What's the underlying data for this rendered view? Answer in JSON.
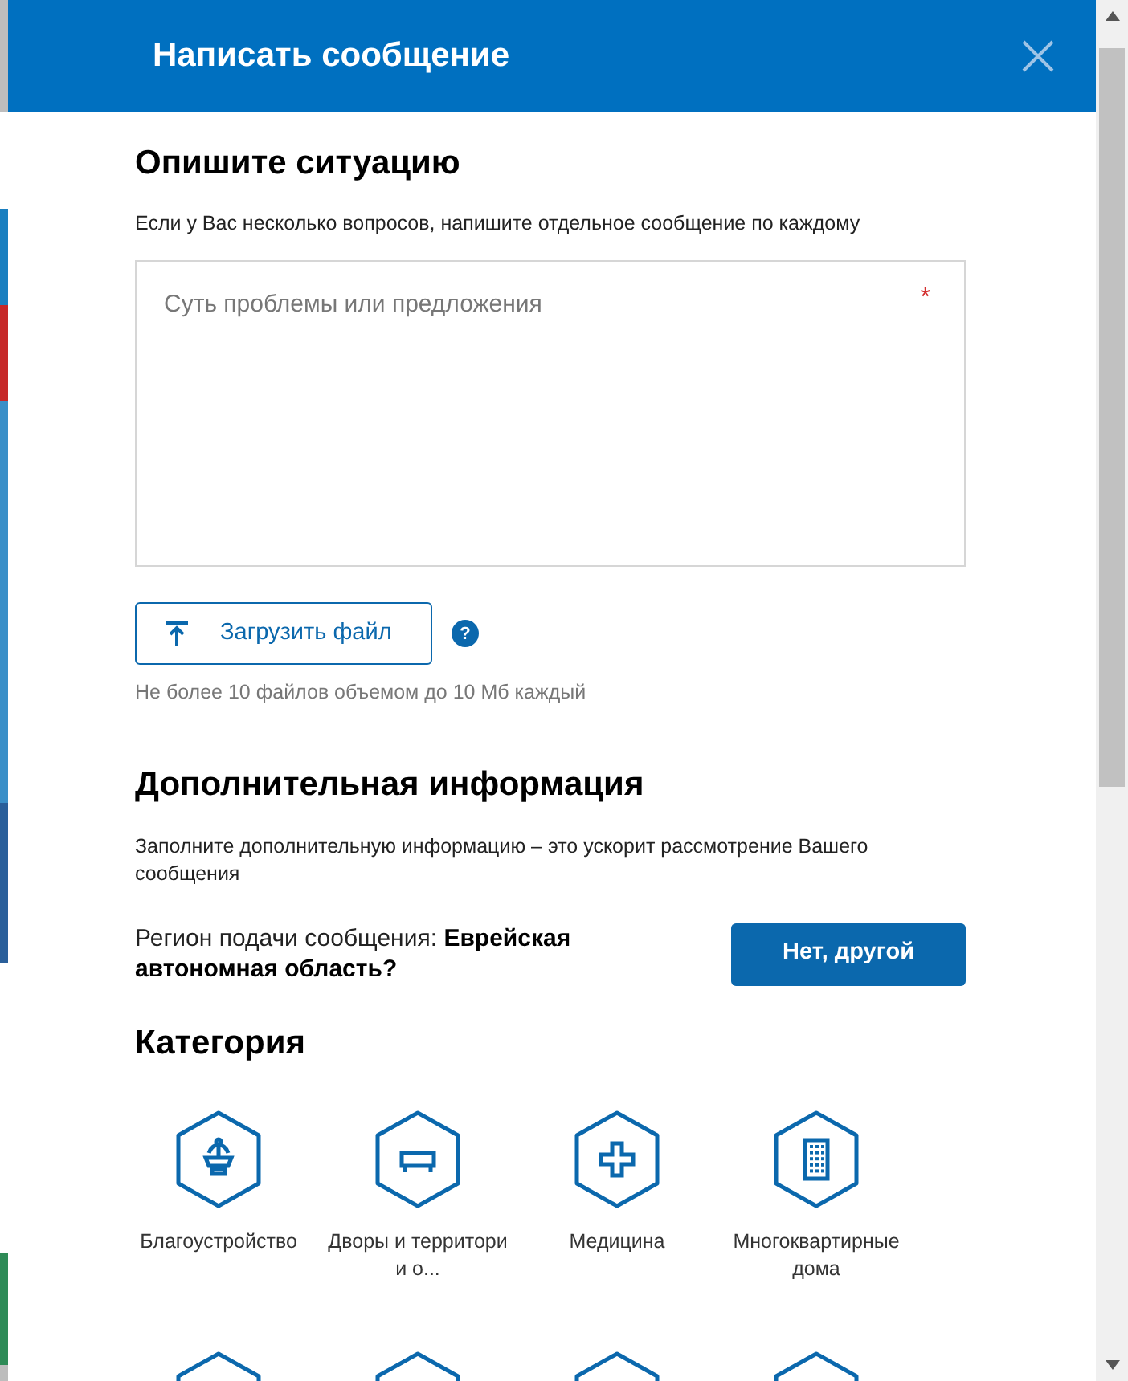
{
  "dialog": {
    "title": "Написать сообщение"
  },
  "describe": {
    "heading": "Опишите ситуацию",
    "hint": "Если у Вас несколько вопросов, напишите отдельное сообщение по каждому",
    "message": {
      "placeholder": "Суть проблемы или предложения",
      "required_mark": "*"
    },
    "upload_button": "Загрузить файл",
    "help": "?",
    "upload_note": "Не более 10 файлов объемом до 10 Мб каждый"
  },
  "additional": {
    "heading": "Дополнительная информация",
    "hint": "Заполните дополнительную информацию – это ускорит рассмотрение Вашего сообщения",
    "region_label": "Регион подачи сообщения:",
    "region_value": "Еврейская автономная область?",
    "other_button": "Нет, другой"
  },
  "category": {
    "heading": "Категория",
    "items": [
      {
        "kind": "labeled",
        "label": "Благоустройство"
      },
      {
        "kind": "labeled",
        "label": "Дворы и территории о..."
      },
      {
        "kind": "labeled",
        "label": "Медицина"
      },
      {
        "kind": "labeled",
        "label": "Многоквартирные дома"
      },
      {
        "kind": "icon_only"
      },
      {
        "kind": "icon_only"
      },
      {
        "kind": "icon_only"
      },
      {
        "kind": "icon_only"
      }
    ]
  }
}
